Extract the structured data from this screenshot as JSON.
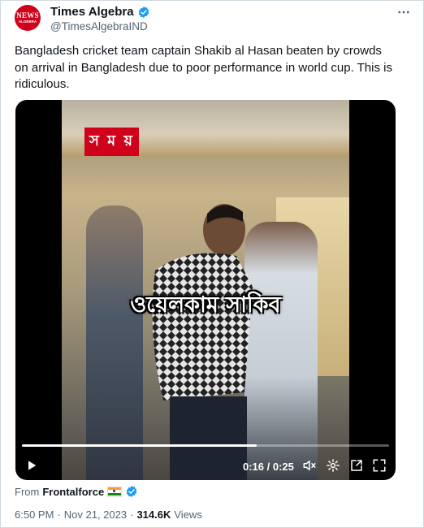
{
  "author": {
    "name": "Times Algebra",
    "handle": "@TimesAlgebraIND",
    "avatar_text": "NEWS",
    "avatar_subtext": "ALGEBRA",
    "verified": true,
    "verified_color": "#1d9bf0"
  },
  "tweet": {
    "text": "Bangladesh cricket team captain Shakib al Hasan beaten by crowds on arrival in Bangladesh due to poor performance in world cup. This is ridiculous."
  },
  "video": {
    "brand_tag": "স ম য়",
    "caption": "ওয়েলকাম সাকিব",
    "current_time": "0:16",
    "duration": "0:25",
    "progress_fraction": 0.64,
    "icons": [
      "play-icon",
      "mute-icon",
      "settings-icon",
      "popout-icon",
      "fullscreen-icon"
    ]
  },
  "source": {
    "prefix": "From",
    "name": "Frontalforce",
    "flag_icon": "india-flag-icon",
    "verified": true
  },
  "meta": {
    "time": "6:50 PM",
    "separator": "·",
    "date": "Nov 21, 2023",
    "views_count": "314.6K",
    "views_label": "Views"
  },
  "colors": {
    "accent": "#1d9bf0",
    "text": "#0f1419",
    "secondary_text": "#536471",
    "brand_red": "#d0021b"
  }
}
